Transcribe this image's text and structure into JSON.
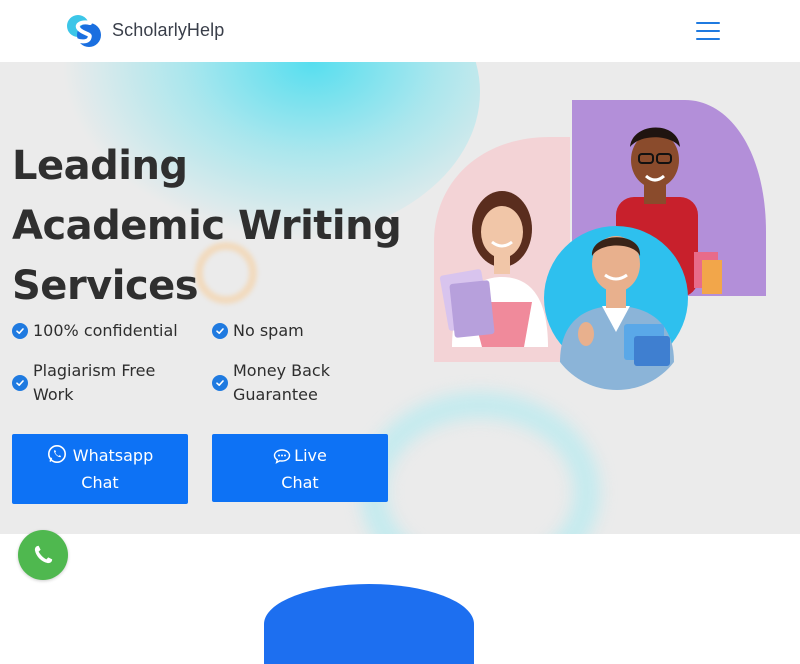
{
  "header": {
    "brand": "ScholarlyHelp",
    "logo_icon": "scholarlyhelp-logo-icon",
    "menu_icon": "hamburger-menu-icon"
  },
  "hero": {
    "headline_lines": [
      "Leading",
      "Academic Writing",
      "Services"
    ],
    "features": [
      {
        "label": "100% confidential",
        "icon": "check-circle-icon"
      },
      {
        "label": "No spam",
        "icon": "check-circle-icon"
      },
      {
        "label_lines": [
          "Plagiarism Free",
          "Work"
        ],
        "icon": "check-circle-icon"
      },
      {
        "label_lines": [
          "Money Back",
          "Guarantee"
        ],
        "icon": "check-circle-icon"
      }
    ],
    "buttons": {
      "whatsapp": {
        "lines": [
          "Whatsapp",
          "Chat"
        ],
        "icon": "whatsapp-icon"
      },
      "live_chat": {
        "lines": [
          "Live",
          "Chat"
        ],
        "icon": "chat-bubble-icon"
      }
    }
  },
  "colors": {
    "accent": "#0d72f5",
    "hero_bg": "#ebebeb",
    "whatsapp_green": "#4fb84f",
    "purple_card": "#b38fd9",
    "cyan_circle": "#2ec0ee"
  }
}
